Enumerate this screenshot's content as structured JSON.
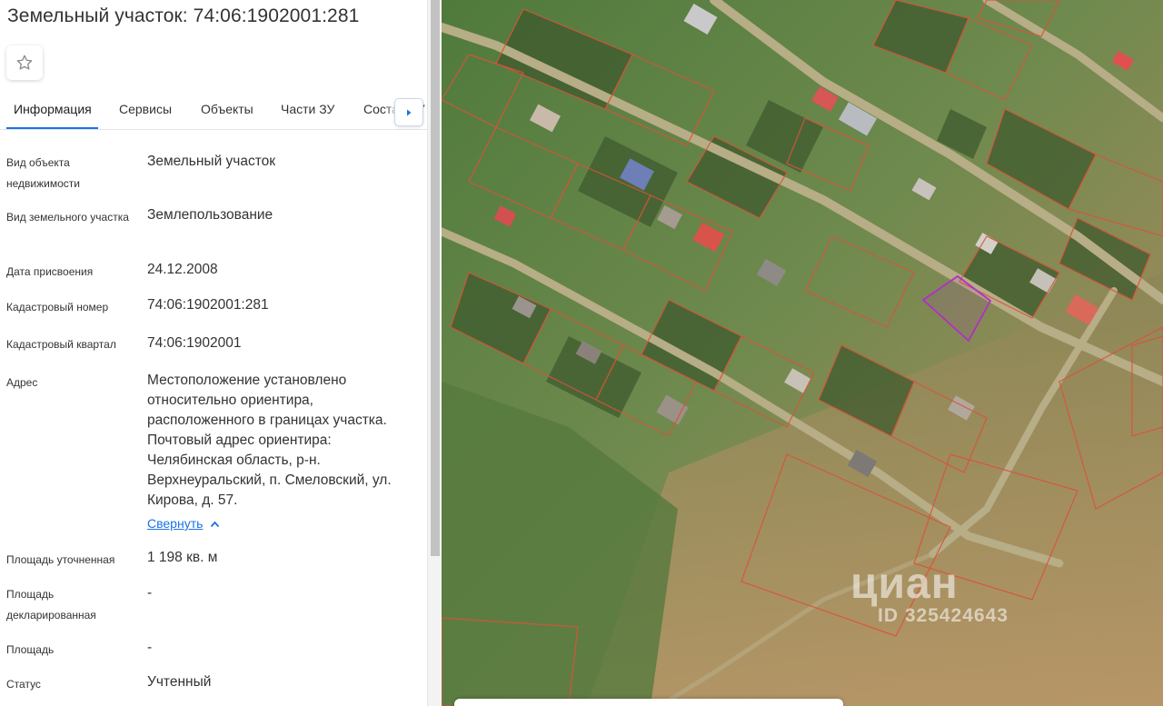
{
  "header": {
    "title": "Земельный участок: 74:06:1902001:281",
    "favorite_icon": "star-outline-icon"
  },
  "tabs": [
    {
      "label": "Информация",
      "active": true
    },
    {
      "label": "Сервисы",
      "active": false
    },
    {
      "label": "Объекты",
      "active": false
    },
    {
      "label": "Части ЗУ",
      "active": false
    },
    {
      "label": "Состав ЗУ",
      "active": false
    }
  ],
  "tabs_scroll_icon": "chevron-right-icon",
  "details": [
    {
      "label": "Вид объекта недвижимости",
      "value": "Земельный участок"
    },
    {
      "label": "Вид земельного участка",
      "value": "Землепользование"
    },
    {
      "label": "Дата присвоения",
      "value": "24.12.2008"
    },
    {
      "label": "Кадастровый номер",
      "value": "74:06:1902001:281"
    },
    {
      "label": "Кадастровый квартал",
      "value": "74:06:1902001"
    },
    {
      "label": "Адрес",
      "value": "Местоположение установлено относительно ориентира, расположенного в границах участка. Почтовый адрес ориентира: Челябинская область, р-н. Верхнеуральский, п. Смеловский, ул. Кирова, д. 57."
    },
    {
      "label": "Площадь уточненная",
      "value": "1 198 кв. м"
    },
    {
      "label": "Площадь декларированная",
      "value": "-"
    },
    {
      "label": "Площадь",
      "value": "-"
    },
    {
      "label": "Статус",
      "value": "Учтенный"
    }
  ],
  "collapse_link": "Свернуть",
  "collapse_icon": "chevron-up-icon",
  "map": {
    "watermark_brand": "циан",
    "watermark_id": "ID 325424643",
    "selected_parcel_color": "#b02fc9",
    "parcel_border_color": "#d9533a"
  },
  "colors": {
    "accent": "#1a73e8"
  }
}
